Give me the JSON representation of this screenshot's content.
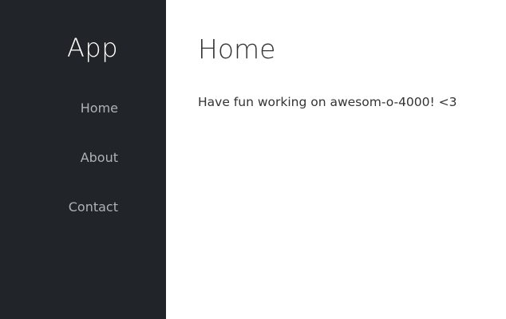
{
  "sidebar": {
    "brand": "App",
    "items": [
      {
        "label": "Home"
      },
      {
        "label": "About"
      },
      {
        "label": "Contact"
      }
    ]
  },
  "main": {
    "title": "Home",
    "text": "Have fun working on awesom-o-4000! <3"
  },
  "colors": {
    "sidebar_background": "#212529",
    "nav_link": "#aeb2b6",
    "brand_text": "#ffffff",
    "main_text": "#333333"
  }
}
